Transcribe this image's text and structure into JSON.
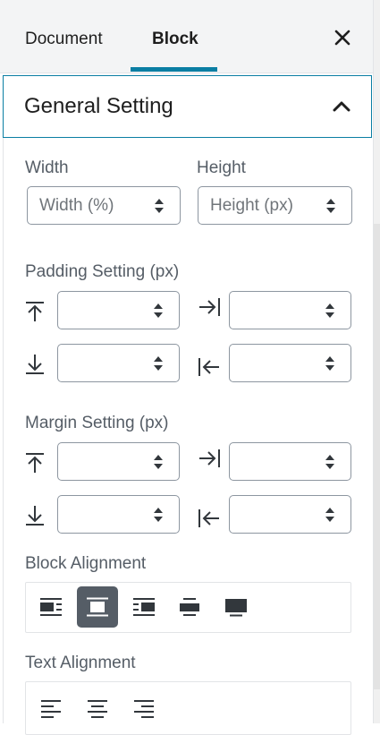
{
  "tabs": {
    "document": "Document",
    "block": "Block"
  },
  "panel": {
    "title": "General Setting"
  },
  "size": {
    "width_label": "Width",
    "height_label": "Height",
    "width_placeholder": "Width (%)",
    "height_placeholder": "Height (px)"
  },
  "padding": {
    "label": "Padding Setting (px)"
  },
  "margin": {
    "label": "Margin Setting (px)"
  },
  "block_alignment": {
    "label": "Block Alignment",
    "options": [
      "wrap-left",
      "center",
      "wrap-right",
      "wide",
      "full"
    ],
    "selected": "center"
  },
  "text_alignment": {
    "label": "Text Alignment",
    "options": [
      "left",
      "center",
      "right"
    ]
  },
  "colors": {
    "accent": "#0a7ea3",
    "active_button": "#555d66"
  }
}
